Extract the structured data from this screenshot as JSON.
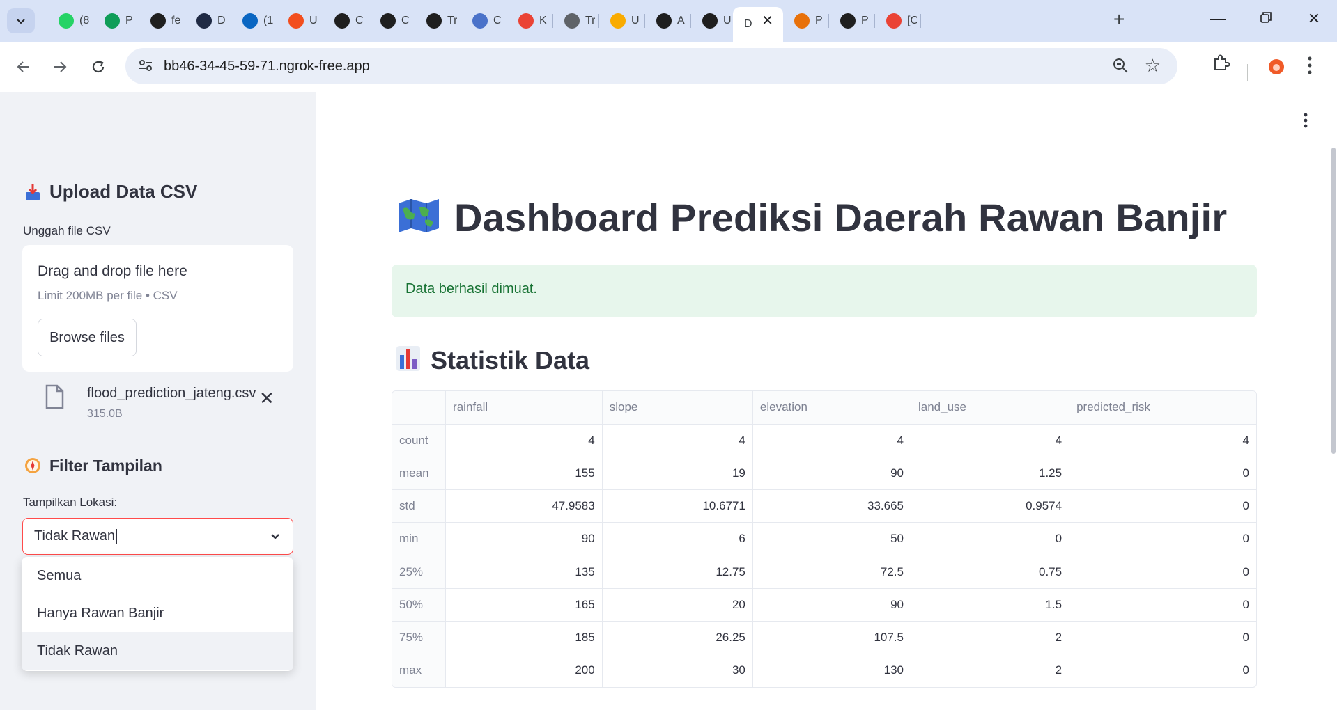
{
  "browser": {
    "tabs": [
      {
        "title": "(8",
        "favicon": "badge-80-icon",
        "color": "#25d366"
      },
      {
        "title": "P",
        "favicon": "google-sheets-icon",
        "color": "#0f9d58"
      },
      {
        "title": "fe",
        "favicon": "github-icon",
        "color": "#1f1f1f"
      },
      {
        "title": "D",
        "favicon": "hex-app-icon",
        "color": "#1f2a44"
      },
      {
        "title": "(1",
        "favicon": "linkedin-icon",
        "color": "#0a66c2"
      },
      {
        "title": "U",
        "favicon": "figma-icon",
        "color": "#f24e1e"
      },
      {
        "title": "C",
        "favicon": "mongodb-icon",
        "color": "#1f1f1f"
      },
      {
        "title": "C",
        "favicon": "mongodb-icon",
        "color": "#1f1f1f"
      },
      {
        "title": "Tr",
        "favicon": "mongodb-icon",
        "color": "#1f1f1f"
      },
      {
        "title": "C",
        "favicon": "shield-icon",
        "color": "#4a72c9"
      },
      {
        "title": "K",
        "favicon": "gmail-icon",
        "color": "#ea4335"
      },
      {
        "title": "Tr",
        "favicon": "globe-icon",
        "color": "#5f6368"
      },
      {
        "title": "U",
        "favicon": "co-logo-icon",
        "color": "#f9ab00"
      },
      {
        "title": "A",
        "favicon": "github-icon",
        "color": "#1f1f1f"
      },
      {
        "title": "U",
        "favicon": "github-icon",
        "color": "#1f1f1f"
      },
      {
        "title": "D",
        "favicon": "none",
        "color": "#ffffff"
      },
      {
        "title": "P",
        "favicon": "loading-spinner-icon",
        "color": "#e8710a"
      },
      {
        "title": "P",
        "favicon": "openai-icon",
        "color": "#1f1f1f"
      },
      {
        "title": "[C",
        "favicon": "gmail-icon",
        "color": "#ea4335"
      }
    ],
    "active_tab_index": 15,
    "url": "bb46-34-45-59-71.ngrok-free.app"
  },
  "sidebar": {
    "upload_heading": "Upload Data CSV",
    "upload_label": "Unggah file CSV",
    "dropzone_title": "Drag and drop file here",
    "dropzone_limit": "Limit 200MB per file • CSV",
    "browse_button": "Browse files",
    "uploaded_file_name": "flood_prediction_jateng.csv",
    "uploaded_file_size": "315.0B",
    "filter_heading": "Filter Tampilan",
    "filter_label": "Tampilkan Lokasi:",
    "select_value": "Tidak Rawan",
    "options": [
      "Semua",
      "Hanya Rawan Banjir",
      "Tidak Rawan"
    ],
    "selected_option_index": 2
  },
  "main": {
    "title": "Dashboard Prediksi Daerah Rawan Banjir",
    "success_message": "Data berhasil dimuat.",
    "section_title": "Statistik Data",
    "table": {
      "columns": [
        "",
        "rainfall",
        "slope",
        "elevation",
        "land_use",
        "predicted_risk"
      ],
      "rows": [
        [
          "count",
          "4",
          "4",
          "4",
          "4",
          "4"
        ],
        [
          "mean",
          "155",
          "19",
          "90",
          "1.25",
          "0"
        ],
        [
          "std",
          "47.9583",
          "10.6771",
          "33.665",
          "0.9574",
          "0"
        ],
        [
          "min",
          "90",
          "6",
          "50",
          "0",
          "0"
        ],
        [
          "25%",
          "135",
          "12.75",
          "72.5",
          "0.75",
          "0"
        ],
        [
          "50%",
          "165",
          "20",
          "90",
          "1.5",
          "0"
        ],
        [
          "75%",
          "185",
          "26.25",
          "107.5",
          "2",
          "0"
        ],
        [
          "max",
          "200",
          "30",
          "130",
          "2",
          "0"
        ]
      ]
    }
  },
  "colors": {
    "accent": "#ff4b4b",
    "sidebar_bg": "#f0f2f6",
    "success_bg": "#e7f6ec",
    "success_text": "#177233",
    "tabstrip_bg": "#d9e3f7"
  }
}
